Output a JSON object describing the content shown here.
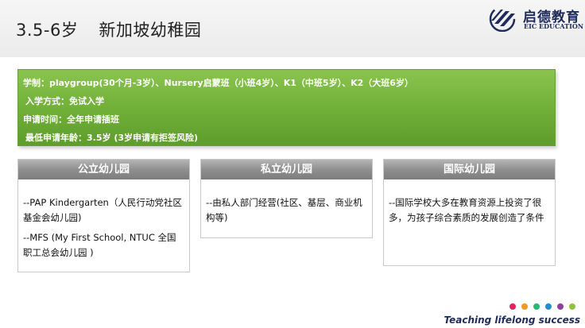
{
  "header": {
    "title_age": "3.5-6岁",
    "title_subject": "新加坡幼稚园",
    "logo": {
      "name_cn": "启德教育",
      "name_en": "EIC EDUCATION",
      "icon": "eic-logo-icon",
      "color": "#1f2c5a"
    }
  },
  "info": {
    "lines": [
      "学制：playgroup(30个月-3岁）、Nursery启蒙班（小班4岁）、K1（中班5岁）、K2（大班6岁）",
      "入学方式：免试入学",
      "申请时间：全年申请插班",
      "最低申请年龄：3.5岁 (3岁申请有拒签风险)"
    ],
    "color": "#6fae37"
  },
  "cards": [
    {
      "title": "公立幼儿园",
      "paragraphs": [
        "--PAP Kindergarten（人民行动党社区基金会幼儿园)",
        "--MFS (My First School, NTUC 全国职工总会幼儿园 )"
      ]
    },
    {
      "title": "私立幼儿园",
      "paragraphs": [
        "--由私人部门经营(社区、基层、商业机构等)"
      ]
    },
    {
      "title": "国际幼儿园",
      "paragraphs": [
        "--国际学校大多在教育资源上投资了很多，为孩子综合素质的发展创造了条件"
      ]
    }
  ],
  "footer": {
    "dot_colors": [
      "#e0245e",
      "#f29a1f",
      "#2bb673",
      "#1f8fd1",
      "#8e3fa0",
      "#8cc63f"
    ],
    "tagline": "Teaching lifelong success"
  }
}
